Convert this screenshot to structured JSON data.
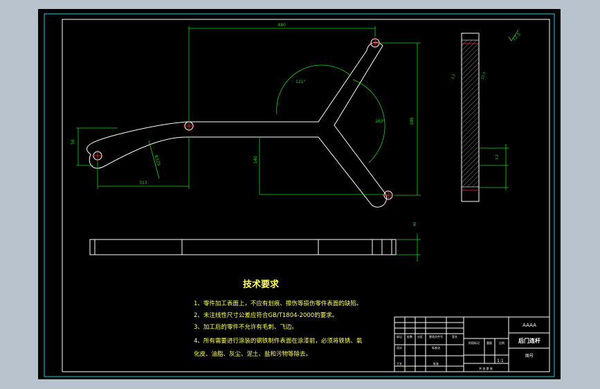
{
  "dimensions": {
    "top_width": "480",
    "angle_top": "121°",
    "angle_right": "163°",
    "right_height": "346",
    "mid_height": "140",
    "bottom_left_width": "313",
    "left_height": "56",
    "radius": "R325",
    "side_width": "40"
  },
  "roughness": {
    "general": "12.5",
    "face_left": "3.2",
    "face_right": "12.5",
    "hole": "3.2"
  },
  "tech_requirements": {
    "title": "技术要求",
    "items": [
      "1、零件加工表面上，不应有划痕、擦伤等损伤零件表面的缺陷。",
      "2、未注线性尺寸公差应符合GB/T1804-2000的要求。",
      "3、加工后的零件不允许有毛刺、飞边。",
      "4、所有需要进行涂装的钢铁制件表面在涂漆前，必须将铁锈、氧"
    ],
    "continuation": "化皮、油脂、灰尘、泥土、盐和污物等除去。"
  },
  "title_block": {
    "material": "AAAA",
    "part_name": "后门连杆",
    "scale": "1:1",
    "drawing_no": "图号",
    "labels": {
      "mark": "标记",
      "count": "处数",
      "zone": "分区",
      "change_doc": "更改文件号",
      "signature": "签名",
      "date": "年月日",
      "design": "设计",
      "standardize": "标准化",
      "process": "工艺",
      "approve": "批准",
      "stage_mark": "阶段标记",
      "weight": "重量",
      "ratio": "比例",
      "sheets": "共 张 第 张"
    }
  },
  "colors": {
    "background": "#000000",
    "outline": "#ffffff",
    "dimension": "#1fd31f",
    "centerline": "#ff2d2d",
    "text": "#ffff66",
    "border": "#19d2e6"
  }
}
